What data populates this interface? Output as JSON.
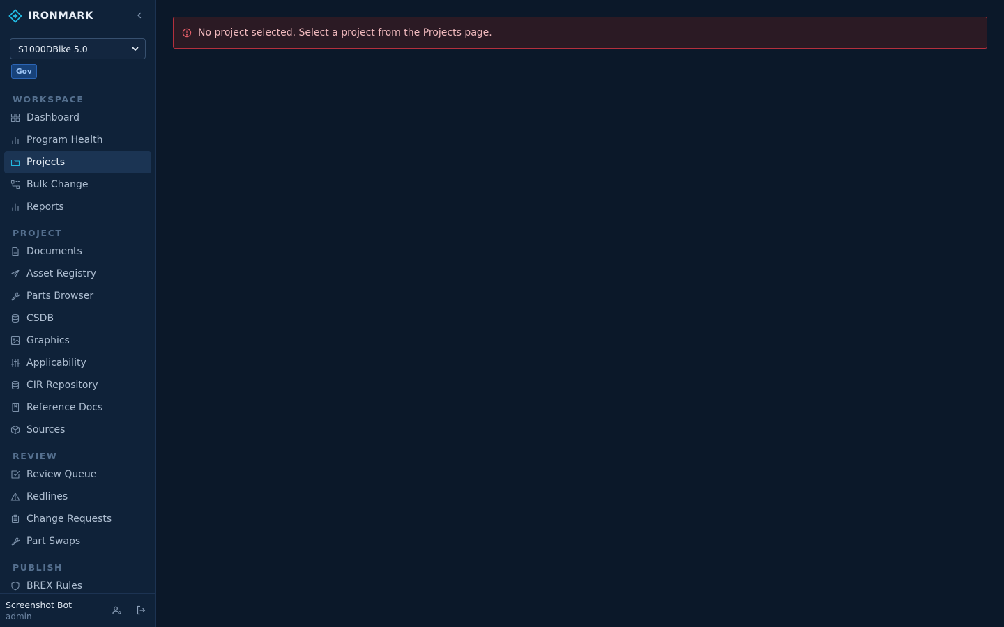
{
  "app": {
    "name": "IRONMARK"
  },
  "project_selector": {
    "selected": "S1000DBike 5.0",
    "badge": "Gov"
  },
  "sidebar": {
    "sections": [
      {
        "label": "WORKSPACE",
        "items": [
          {
            "label": "Dashboard",
            "icon": "grid-icon"
          },
          {
            "label": "Program Health",
            "icon": "bar-chart-icon"
          },
          {
            "label": "Projects",
            "icon": "folder-icon",
            "active": true
          },
          {
            "label": "Bulk Change",
            "icon": "workflow-icon"
          },
          {
            "label": "Reports",
            "icon": "bar-chart-icon"
          }
        ]
      },
      {
        "label": "PROJECT",
        "items": [
          {
            "label": "Documents",
            "icon": "file-text-icon"
          },
          {
            "label": "Asset Registry",
            "icon": "plane-icon"
          },
          {
            "label": "Parts Browser",
            "icon": "wrench-icon"
          },
          {
            "label": "CSDB",
            "icon": "database-icon"
          },
          {
            "label": "Graphics",
            "icon": "image-icon"
          },
          {
            "label": "Applicability",
            "icon": "sliders-icon"
          },
          {
            "label": "CIR Repository",
            "icon": "database-icon"
          },
          {
            "label": "Reference Docs",
            "icon": "book-icon"
          },
          {
            "label": "Sources",
            "icon": "package-icon"
          }
        ]
      },
      {
        "label": "REVIEW",
        "items": [
          {
            "label": "Review Queue",
            "icon": "check-square-icon"
          },
          {
            "label": "Redlines",
            "icon": "alert-triangle-icon"
          },
          {
            "label": "Change Requests",
            "icon": "clipboard-icon"
          },
          {
            "label": "Part Swaps",
            "icon": "wrench-icon"
          }
        ]
      },
      {
        "label": "PUBLISH",
        "items": [
          {
            "label": "BREX Rules",
            "icon": "shield-icon"
          }
        ]
      }
    ]
  },
  "user": {
    "name": "Screenshot Bot",
    "role": "admin"
  },
  "alert": {
    "message": "No project selected. Select a project from the Projects page.",
    "icon": "alert-circle-icon"
  },
  "colors": {
    "accent": "#22b8e0",
    "error_border": "#b4303d",
    "error_text": "#f0b9bd"
  }
}
